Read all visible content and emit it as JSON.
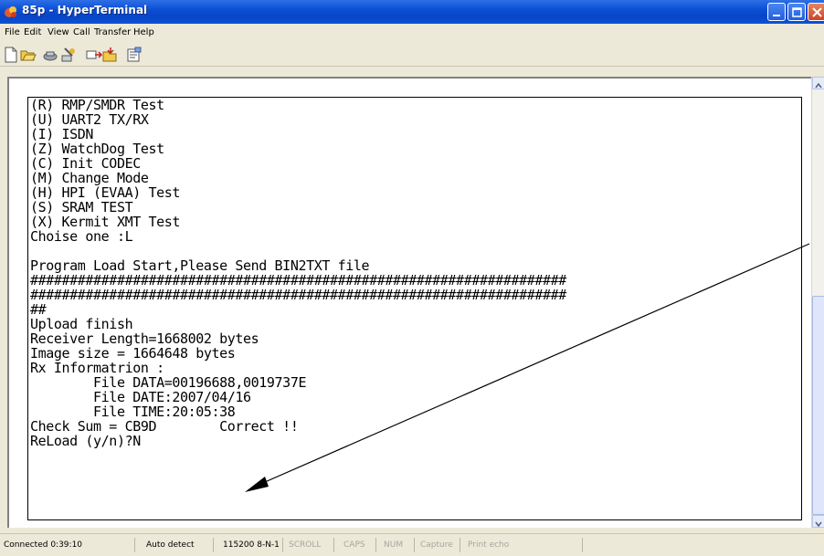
{
  "window": {
    "title": "85p - HyperTerminal",
    "app_icon": "hyperterminal-icon"
  },
  "menu": [
    {
      "label": "File"
    },
    {
      "label": "Edit"
    },
    {
      "label": "View"
    },
    {
      "label": "Call"
    },
    {
      "label": "Transfer"
    },
    {
      "label": "Help"
    }
  ],
  "toolbar": [
    {
      "icon": "new-connection-icon"
    },
    {
      "icon": "open-icon"
    },
    {
      "icon": "call-icon"
    },
    {
      "icon": "disconnect-icon"
    },
    {
      "icon": "send-icon"
    },
    {
      "icon": "receive-icon"
    },
    {
      "icon": "properties-icon"
    }
  ],
  "terminal": {
    "lines": [
      "(R) RMP/SMDR Test",
      "(U) UART2 TX/RX",
      "(I) ISDN",
      "(Z) WatchDog Test",
      "(C) Init CODEC",
      "(M) Change Mode",
      "(H) HPI (EVAA) Test",
      "(S) SRAM TEST",
      "(X) Kermit XMT Test",
      "Choise one :L",
      "",
      "Program Load Start,Please Send BIN2TXT file",
      "####################################################################",
      "####################################################################",
      "##",
      "Upload finish",
      "Receiver Length=1668002 bytes",
      "Image size = 1664648 bytes",
      "Rx Informatrion :",
      "        File DATA=00196688,0019737E",
      "        File DATE:2007/04/16",
      "        File TIME:20:05:38",
      "Check Sum = CB9D        Correct !!",
      "ReLoad (y/n)?N"
    ]
  },
  "statusbar": {
    "connected": "Connected 0:39:10",
    "detect": "Auto detect",
    "port": "115200 8-N-1",
    "scroll": "SCROLL",
    "caps": "CAPS",
    "num": "NUM",
    "capture": "Capture",
    "print_echo": "Print echo"
  },
  "colors": {
    "title_bar": "#0a4fd6",
    "terminal_bg": "#ffffff",
    "terminal_text": "#000000",
    "annotation_arrow": "#000000"
  }
}
